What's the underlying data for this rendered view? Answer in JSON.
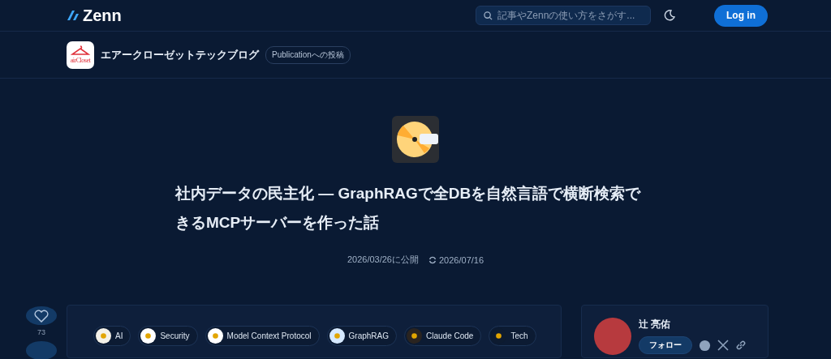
{
  "header": {
    "logo": "Zenn",
    "search": {
      "placeholder": "記事やZennの使い方をさがす..."
    },
    "login": "Log in"
  },
  "publication": {
    "logo_text": "airCloset",
    "name": "エアークローゼットテックブログ",
    "badge": "Publicationへの投稿"
  },
  "article": {
    "title": "社内データの民主化 — GraphRAGで全DBを自然言語で横断検索できるMCPサーバーを作った話",
    "published": "2026/03/26に公開",
    "updated": "2026/07/16"
  },
  "likes": {
    "count": "73"
  },
  "topics": [
    {
      "label": "AI",
      "color": "#f4f1e8"
    },
    {
      "label": "Security",
      "color": "#ffffff"
    },
    {
      "label": "Model Context Protocol",
      "color": "#ffffff"
    },
    {
      "label": "GraphRAG",
      "color": "#d6e9ff"
    },
    {
      "label": "Claude Code",
      "color": "#2a2420"
    },
    {
      "label": "Tech",
      "color": "#0d1b30"
    }
  ],
  "author": {
    "name": "辻 亮佑",
    "follow": "フォロー"
  }
}
